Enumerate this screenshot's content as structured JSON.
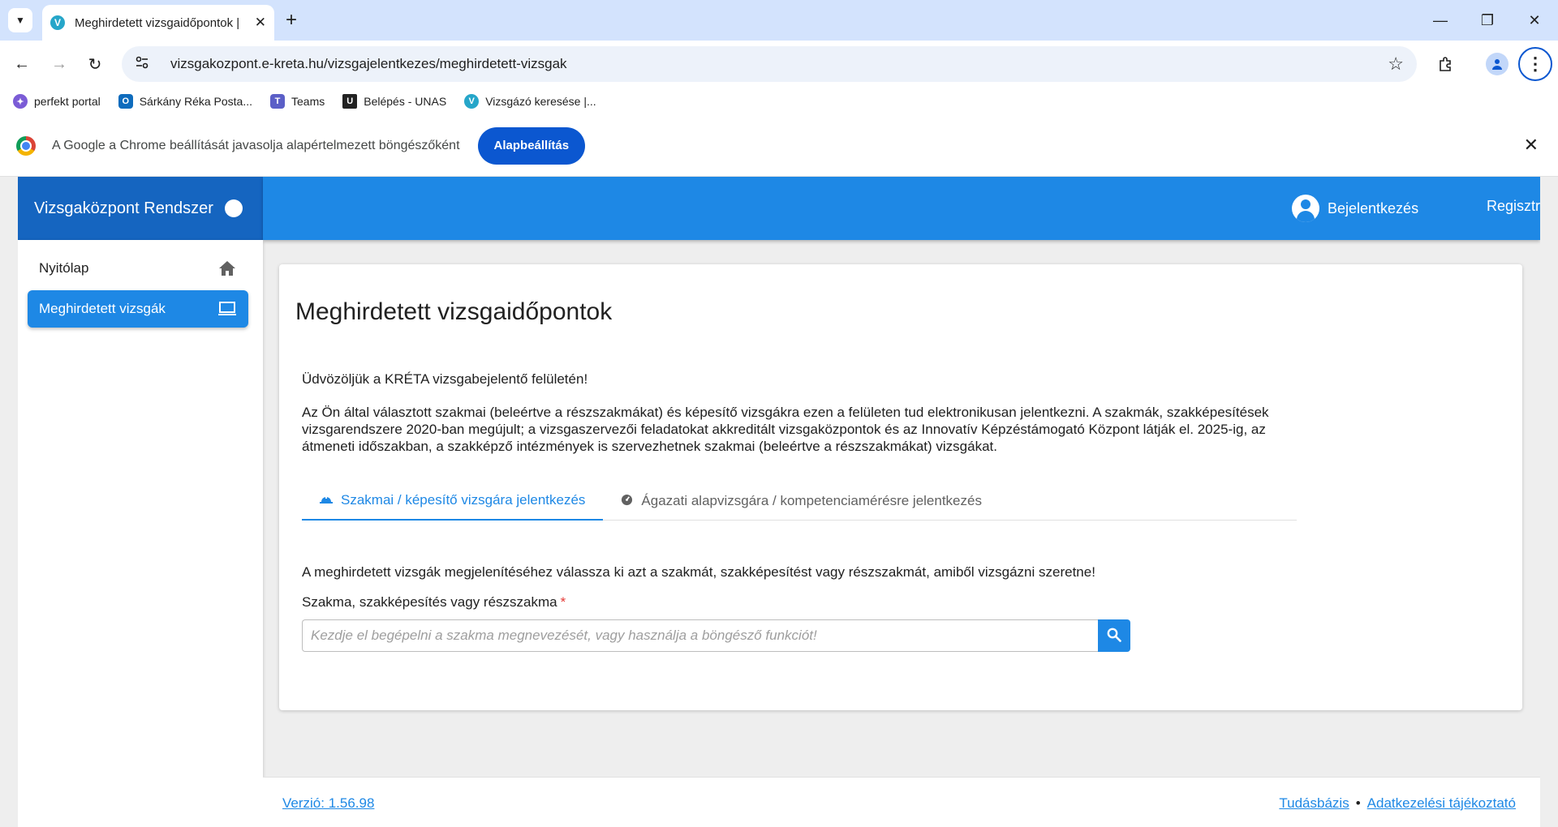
{
  "browser": {
    "tab_title": "Meghirdetett vizsgaidőpontok | ",
    "favicon_letter": "V",
    "url": "vizsgakozpont.e-kreta.hu/vizsgajelentkezes/meghirdetett-vizsgak",
    "bookmarks": [
      {
        "label": "perfekt portal",
        "icon": "perfekt-icon",
        "color": "#7b5cd6"
      },
      {
        "label": "Sárkány Réka Posta...",
        "icon": "outlook-icon",
        "color": "#0f6cbd"
      },
      {
        "label": "Teams",
        "icon": "teams-icon",
        "color": "#5b5fc7"
      },
      {
        "label": "Belépés - UNAS",
        "icon": "unas-icon",
        "color": "#222222"
      },
      {
        "label": "Vizsgázó keresése |...",
        "icon": "vizsgakozpont-icon",
        "color": "#26a6c9"
      }
    ],
    "infobar": {
      "text": "A Google a Chrome beállítását javasolja alapértelmezett böngészőként",
      "button": "Alapbeállítás"
    }
  },
  "app": {
    "brand": "Vizsgaközpont Rendszer",
    "login": "Bejelentkezés",
    "register": "Regisztráció",
    "sidebar": [
      {
        "label": "Nyitólap",
        "icon": "home-icon"
      },
      {
        "label": "Meghirdetett vizsgák",
        "icon": "laptop-icon",
        "active": true
      }
    ],
    "title": "Meghirdetett vizsgaidőpontok",
    "welcome": "Üdvözöljük a KRÉTA vizsgabejelentő felületén!",
    "intro": "Az Ön által választott szakmai (beleértve a részszakmákat) és képesítő vizsgákra ezen a felületen tud elektronikusan jelentkezni. A szakmák, szakképesítések vizsgarendszere 2020-ban megújult; a vizsgaszervezői feladatokat akkreditált vizsgaközpontok és az Innovatív Képzéstámogató Központ látják el. 2025-ig, az átmeneti időszakban, a szakképző intézmények is szervezhetnek szakmai (beleértve a részszakmákat) vizsgákat.",
    "tabs": [
      {
        "label": "Szakmai / képesítő vizsgára jelentkezés",
        "icon": "helmet-icon",
        "active": true
      },
      {
        "label": "Ágazati alapvizsgára / kompetenciamérésre jelentkezés",
        "icon": "gauge-icon",
        "active": false
      }
    ],
    "instruction": "A meghirdetett vizsgák megjelenítéséhez válassza ki azt a szakmát, szakképesítést vagy részszakmát, amiből vizsgázni szeretne!",
    "field_label": "Szakma, szakképesítés vagy részszakma",
    "required_mark": "*",
    "search_placeholder": "Kezdje el begépelni a szakma megnevezését, vagy használja a böngésző funkciót!",
    "search_value": "",
    "footer": {
      "version": "Verzió: 1.56.98",
      "link1": "Tudásbázis",
      "separator": "•",
      "link2": "Adatkezelési tájékoztató"
    }
  },
  "colors": {
    "primary": "#1e88e5",
    "brand_dark": "#1565c0",
    "chrome_accent": "#0b57d0"
  }
}
